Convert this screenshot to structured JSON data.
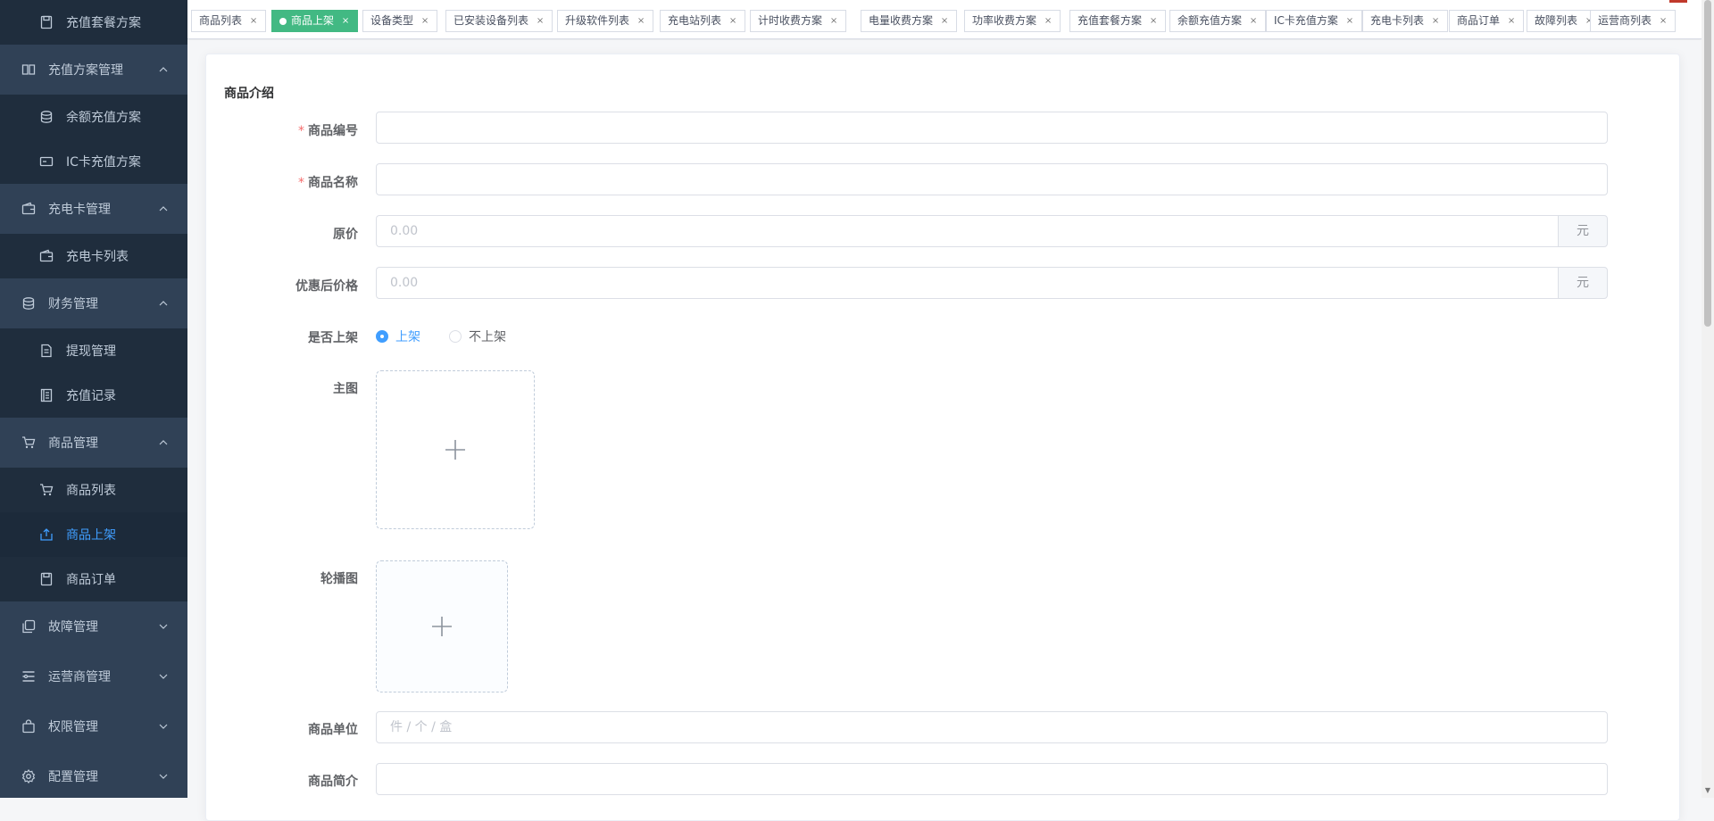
{
  "sidebar": {
    "items": [
      {
        "label": "充值套餐方案",
        "icon": "save-icon",
        "type": "child"
      },
      {
        "label": "充值方案管理",
        "icon": "book-icon",
        "type": "parent",
        "arrow": "up"
      },
      {
        "label": "余额充值方案",
        "icon": "database-icon",
        "type": "child"
      },
      {
        "label": "IC卡充值方案",
        "icon": "card-icon",
        "type": "child"
      },
      {
        "label": "充电卡管理",
        "icon": "wallet-icon",
        "type": "parent",
        "arrow": "up"
      },
      {
        "label": "充电卡列表",
        "icon": "wallet-icon",
        "type": "child"
      },
      {
        "label": "财务管理",
        "icon": "database-icon",
        "type": "parent",
        "arrow": "up"
      },
      {
        "label": "提现管理",
        "icon": "document-icon",
        "type": "child"
      },
      {
        "label": "充值记录",
        "icon": "notebook-icon",
        "type": "child"
      },
      {
        "label": "商品管理",
        "icon": "cart-icon",
        "type": "parent",
        "arrow": "up"
      },
      {
        "label": "商品列表",
        "icon": "cart-icon",
        "type": "child"
      },
      {
        "label": "商品上架",
        "icon": "upload-icon",
        "type": "child",
        "active": true
      },
      {
        "label": "商品订单",
        "icon": "save-icon",
        "type": "child"
      },
      {
        "label": "故障管理",
        "icon": "copy-icon",
        "type": "parent",
        "arrow": "down"
      },
      {
        "label": "运营商管理",
        "icon": "list-icon",
        "type": "parent",
        "arrow": "down"
      },
      {
        "label": "权限管理",
        "icon": "bag-icon",
        "type": "parent",
        "arrow": "down"
      },
      {
        "label": "配置管理",
        "icon": "gear-icon",
        "type": "parent",
        "arrow": "down"
      }
    ]
  },
  "tags": [
    {
      "label": "商品列表"
    },
    {
      "label": "商品上架",
      "active": true
    },
    {
      "label": "设备类型"
    },
    {
      "label": "已安装设备列表"
    },
    {
      "label": "升级软件列表"
    },
    {
      "label": "充电站列表"
    },
    {
      "label": "计时收费方案"
    },
    {
      "label": "电量收费方案"
    },
    {
      "label": "功率收费方案"
    },
    {
      "label": "充值套餐方案"
    },
    {
      "label": "余额充值方案"
    },
    {
      "label": "IC卡充值方案"
    },
    {
      "label": "充电卡列表"
    },
    {
      "label": "商品订单"
    },
    {
      "label": "故障列表"
    },
    {
      "label": "运营商列表"
    }
  ],
  "tag_close": "×",
  "form": {
    "section_title": "商品介绍",
    "required_mark": "*",
    "code_label": "商品编号",
    "name_label": "商品名称",
    "price_label": "原价",
    "price_placeholder": "0.00",
    "price_unit": "元",
    "discount_label": "优惠后价格",
    "discount_placeholder": "0.00",
    "discount_unit": "元",
    "shelf_label": "是否上架",
    "shelf_options": [
      "上架",
      "不上架"
    ],
    "shelf_selected": "上架",
    "main_image_label": "主图",
    "carousel_label": "轮播图",
    "unit_label": "商品单位",
    "unit_placeholder": "件 / 个 / 盒",
    "intro_label": "商品简介"
  },
  "colors": {
    "sidebar_bg": "#304156",
    "sidebar_child_bg": "#1f2d3d",
    "active_text": "#409eff",
    "active_tag": "#42b983",
    "required": "#f56c6c"
  }
}
